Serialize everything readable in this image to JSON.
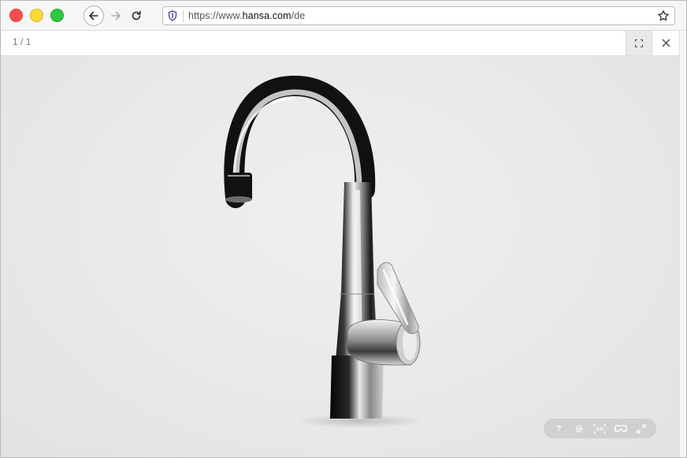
{
  "browser": {
    "url_prefix": "https://www.",
    "url_domain": "hansa.com",
    "url_path": "/de",
    "icons": {
      "back": "arrow-left-icon",
      "forward": "arrow-right-icon",
      "reload": "reload-icon",
      "security": "shield-icon",
      "bookmark": "star-icon"
    }
  },
  "viewer": {
    "counter": "1 / 1",
    "icons": {
      "fullscreen": "fullscreen-corners-icon",
      "close": "close-icon"
    },
    "controls": [
      {
        "name": "help-button",
        "icon": "help-icon",
        "glyph": "?"
      },
      {
        "name": "settings-button",
        "icon": "gear-icon",
        "glyph": ""
      },
      {
        "name": "ar-button",
        "icon": "ar-icon",
        "glyph": "AR"
      },
      {
        "name": "vr-button",
        "icon": "vr-headset-icon",
        "glyph": ""
      },
      {
        "name": "expand-button",
        "icon": "expand-icon",
        "glyph": ""
      }
    ]
  },
  "content": {
    "product": "chrome-kitchen-faucet-3d-model"
  },
  "colors": {
    "stage_background": "#e9e9e9",
    "traffic_red": "#fc4d4d",
    "traffic_yellow": "#fdd935",
    "traffic_green": "#2bc840",
    "control_pill": "#cfcfcf"
  }
}
